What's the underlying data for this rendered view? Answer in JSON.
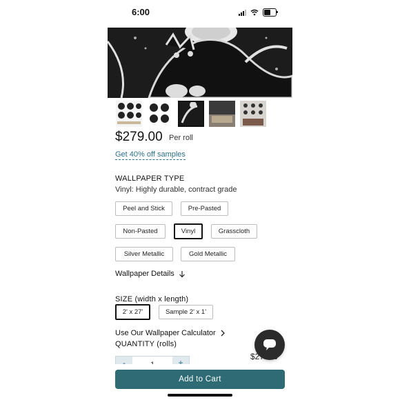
{
  "status_bar": {
    "time": "6:00"
  },
  "product": {
    "price": "$279.00",
    "price_unit": "Per roll",
    "samples_link": "Get 40% off samples"
  },
  "wallpaper_type": {
    "title": "WALLPAPER TYPE",
    "selected_description": "Vinyl: Highly durable, contract grade",
    "options": [
      "Peel and Stick",
      "Pre-Pasted",
      "Non-Pasted",
      "Vinyl",
      "Grasscloth",
      "Silver Metallic",
      "Gold Metallic"
    ],
    "selected": "Vinyl"
  },
  "details_label": "Wallpaper Details",
  "size": {
    "title": "SIZE (width x length)",
    "options": [
      "2' x 27'",
      "Sample 2' x 1'"
    ],
    "selected": "2' x 27'"
  },
  "calculator_label": "Use Our Wallpaper Calculator",
  "quantity": {
    "title": "QUANTITY (rolls)",
    "value": "1",
    "minus": "-",
    "plus": "+"
  },
  "total_partial": "$27..00",
  "cart_button": "Add to Cart",
  "icons": {
    "details": "arrow-down-icon",
    "calculator": "chevron-right-icon",
    "chat": "chat-bubble-icon"
  },
  "colors": {
    "accent": "#2e6b74",
    "link": "#2b6f8a",
    "chat": "#2b2b2b"
  }
}
